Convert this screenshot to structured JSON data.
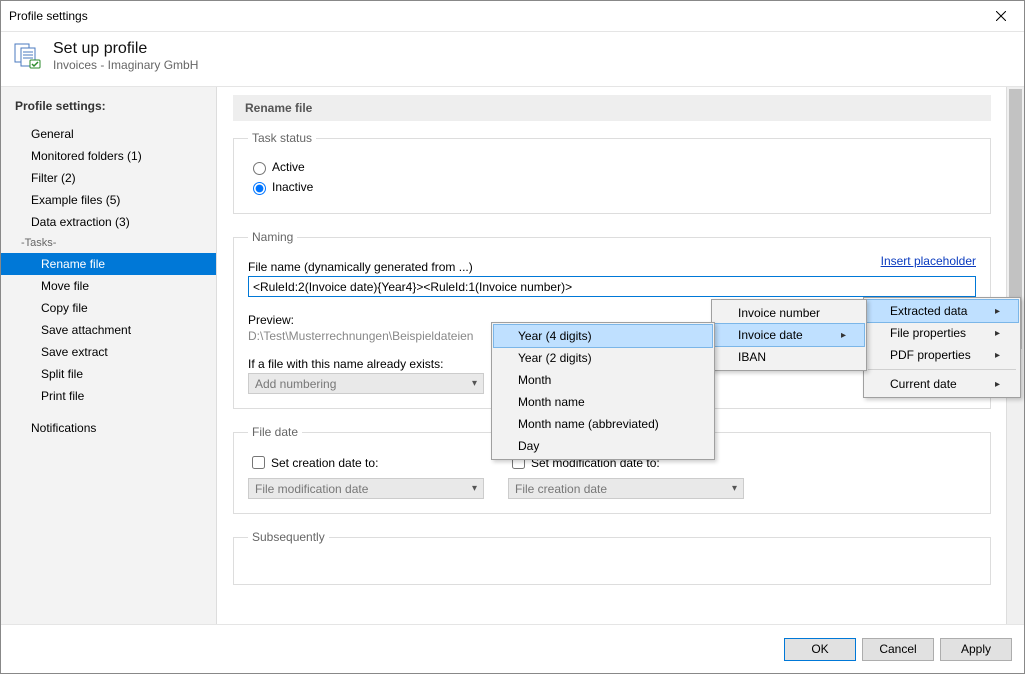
{
  "window": {
    "title": "Profile settings"
  },
  "header": {
    "title": "Set up profile",
    "subtitle": "Invoices - Imaginary GmbH"
  },
  "sidebar": {
    "heading": "Profile settings:",
    "items": [
      {
        "label": "General"
      },
      {
        "label": "Monitored folders (1)"
      },
      {
        "label": "Filter (2)"
      },
      {
        "label": "Example files (5)"
      },
      {
        "label": "Data extraction (3)"
      }
    ],
    "tasks_header": "-Tasks-",
    "tasks": [
      {
        "label": "Rename file",
        "selected": true
      },
      {
        "label": "Move file"
      },
      {
        "label": "Copy file"
      },
      {
        "label": "Save attachment"
      },
      {
        "label": "Save extract"
      },
      {
        "label": "Split file"
      },
      {
        "label": "Print file"
      }
    ],
    "footer_item": {
      "label": "Notifications"
    }
  },
  "panel": {
    "title": "Rename file",
    "task_status": {
      "legend": "Task status",
      "active_label": "Active",
      "inactive_label": "Inactive",
      "selected": "inactive"
    },
    "naming": {
      "legend": "Naming",
      "filename_label": "File name (dynamically generated from ...)",
      "insert_placeholder_link": "Insert placeholder",
      "filename_value": "<RuleId:2(Invoice date){Year4}><RuleId:1(Invoice number)>",
      "preview_label": "Preview:",
      "preview_value": "D:\\Test\\Musterrechnungen\\Beispieldateien",
      "exists_label": "If a file with this name already exists:",
      "exists_value": "Add numbering"
    },
    "filedate": {
      "legend": "File date",
      "creation_label": "Set creation date to:",
      "creation_select": "File modification date",
      "modification_label": "Set modification date to:",
      "modification_select": "File creation date"
    },
    "subsequently_legend": "Subsequently"
  },
  "menus": {
    "level1": {
      "items": [
        {
          "label": "Extracted data",
          "submenu": true,
          "highlight": true
        },
        {
          "label": "File properties",
          "submenu": true
        },
        {
          "label": "PDF properties",
          "submenu": true
        }
      ],
      "sep_after": 2,
      "tail": [
        {
          "label": "Current date",
          "submenu": true
        }
      ]
    },
    "level2": {
      "items": [
        {
          "label": "Invoice number"
        },
        {
          "label": "Invoice date",
          "submenu": true,
          "highlight": true
        },
        {
          "label": "IBAN"
        }
      ]
    },
    "level3": {
      "items": [
        {
          "label": "Year (4 digits)",
          "highlight": true
        },
        {
          "label": "Year (2 digits)"
        },
        {
          "label": "Month"
        },
        {
          "label": "Month name"
        },
        {
          "label": "Month name (abbreviated)"
        },
        {
          "label": "Day"
        }
      ]
    }
  },
  "footer": {
    "ok": "OK",
    "cancel": "Cancel",
    "apply": "Apply"
  }
}
